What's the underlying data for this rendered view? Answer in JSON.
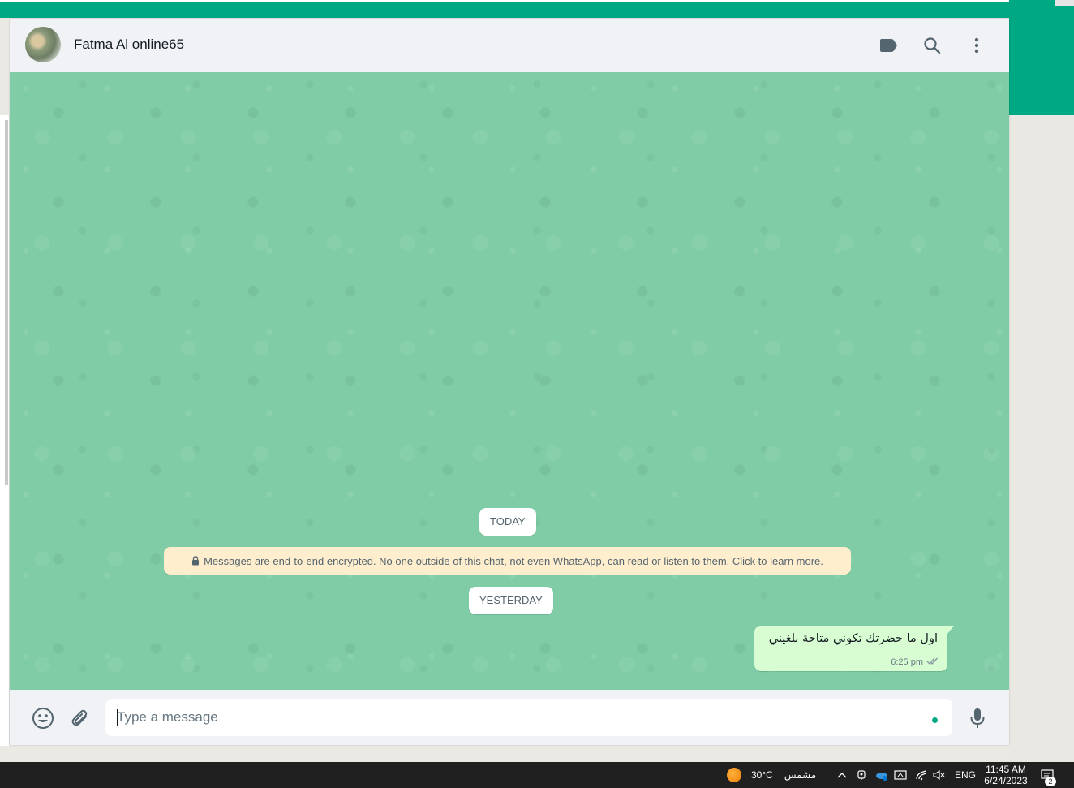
{
  "chat": {
    "contact_name": "Fatma Al online65",
    "icons": {
      "label": "label-icon",
      "search": "search-icon",
      "menu": "kebab-menu-icon"
    },
    "date_chips": [
      "TODAY",
      "YESTERDAY"
    ],
    "encryption_notice": "Messages are end-to-end encrypted. No one outside of this chat, not even WhatsApp, can read or listen to them. Click to learn more.",
    "messages": [
      {
        "direction": "outgoing",
        "text": "اول ما حضرتك تكوني متاحة بلغيني",
        "time": "6:25 pm",
        "status": "read"
      }
    ]
  },
  "composer": {
    "placeholder": "Type a message",
    "value": ""
  },
  "taskbar": {
    "temperature": "30°C",
    "weather": "مشمس",
    "language": "ENG",
    "time": "11:45 AM",
    "date": "6/24/2023",
    "notification_count": "2"
  },
  "colors": {
    "accent": "#00a884",
    "chat_background": "#7fcca6",
    "outgoing_bubble": "#d9fdd3",
    "notice_background": "#ffeecd",
    "taskbar": "#202020"
  }
}
